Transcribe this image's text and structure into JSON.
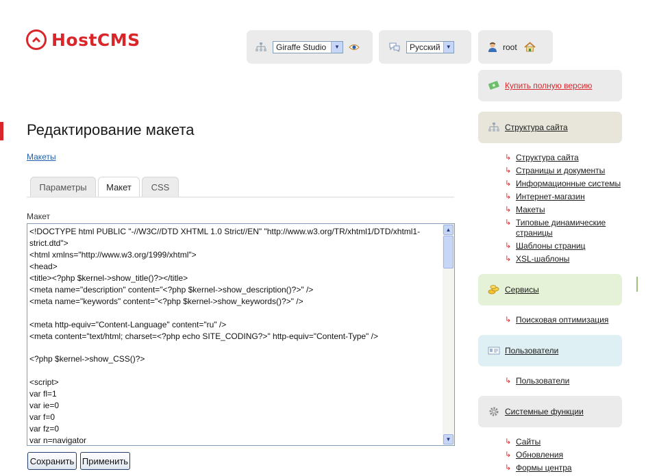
{
  "logo": {
    "text": "HostCMS"
  },
  "site_selector": {
    "value": "Giraffe Studio"
  },
  "lang_selector": {
    "value": "Русский"
  },
  "user": {
    "name": "root"
  },
  "page": {
    "title": "Редактирование макета",
    "breadcrumb": "Макеты"
  },
  "tabs": [
    {
      "label": "Параметры",
      "active": false
    },
    {
      "label": "Макет",
      "active": true
    },
    {
      "label": "CSS",
      "active": false
    }
  ],
  "editor": {
    "label": "Макет",
    "lines": [
      "<!DOCTYPE html PUBLIC \"-//W3C//DTD XHTML 1.0 Strict//EN\" \"http://www.w3.org/TR/xhtml1/DTD/xhtml1-strict.dtd\">",
      "<html xmlns=\"http://www.w3.org/1999/xhtml\">",
      "<head>",
      "<title><?php $kernel->show_title()?></title>",
      "<meta name=\"description\" content=\"<?php $kernel->show_description()?>\" />",
      "<meta name=\"keywords\" content=\"<?php $kernel->show_keywords()?>\" />",
      "",
      "<meta http-equiv=\"Content-Language\" content=\"ru\" />",
      "<meta content=\"text/html; charset=<?php echo SITE_CODING?>\" http-equiv=\"Content-Type\" />",
      "",
      "<?php $kernel->show_CSS()?>",
      "",
      "<script>",
      "var fl=1",
      "var ie=0",
      "var f=0",
      "var fz=0",
      "var n=navigator"
    ]
  },
  "buttons": {
    "save": "Сохранить",
    "apply": "Применить"
  },
  "sidebar": {
    "buy": "Купить полную версию",
    "structure": {
      "title": "Структура сайта",
      "items": [
        "Структура сайта",
        "Страницы и документы",
        "Информационные системы",
        "Интернет-магазин",
        "Макеты",
        "Типовые динамические страницы",
        "Шаблоны страниц",
        "XSL-шаблоны"
      ]
    },
    "services": {
      "title": "Сервисы",
      "items": [
        "Поисковая оптимизация"
      ]
    },
    "users": {
      "title": "Пользователи",
      "items": [
        "Пользователи"
      ]
    },
    "system": {
      "title": "Системные функции",
      "items": [
        "Сайты",
        "Обновления",
        "Формы центра"
      ]
    }
  },
  "colors": {
    "brand": "#d9262b",
    "link": "#1f5fa8"
  }
}
